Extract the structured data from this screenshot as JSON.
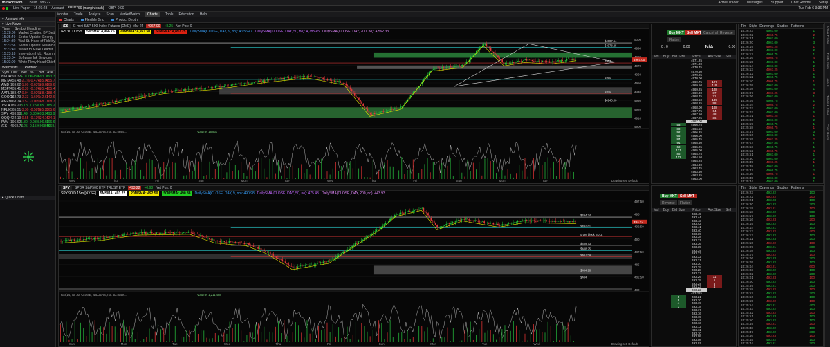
{
  "app": {
    "name": "thinkorswim",
    "build": "Build 1986.22",
    "time": "15:26:23",
    "clock": "Tue Feb 6  3:36 PM",
    "paper_label": "Live Paper",
    "account_label": "Account",
    "account_value": "******769 (margin/cash)",
    "bp_label": "OBP: 0.00"
  },
  "top_links": [
    "Active Trader",
    "Messages",
    "Support",
    "Chat Rooms",
    "Setup"
  ],
  "menu": [
    "Monitor",
    "Trade",
    "Analyze",
    "Scan",
    "MarketWatch",
    "Charts",
    "Tools",
    "Education",
    "Help"
  ],
  "active_menu": "Charts",
  "toolbar": [
    "Charts",
    "Flexible Grid",
    "Product Depth"
  ],
  "sidebar": {
    "account_info": "Account Info",
    "live_news": "Live News",
    "news_headers": [
      "Time",
      "Symbol",
      "Headline"
    ],
    "news": [
      {
        "t": "15:28:06",
        "h": "Market Chatter: BP Settles..."
      },
      {
        "t": "15:25:49",
        "h": "Sector Update: Energy"
      },
      {
        "t": "15:24:30",
        "h": "Wall St. Head of Fidelity P..."
      },
      {
        "t": "15:23:56",
        "h": "Sector Update: Financial"
      },
      {
        "t": "15:23:40",
        "h": "Waller to Make Leader..."
      },
      {
        "t": "15:23:18",
        "h": "Innovation Hub: Robinhood..."
      },
      {
        "t": "15:23:04",
        "h": "Software Ink Services"
      },
      {
        "t": "15:23:00",
        "h": "White Pkwy Head Chief..."
      }
    ],
    "watchlist_tabs": [
      "Watchlists",
      "Portfolio"
    ],
    "wl_headers": [
      "Sym",
      "Last",
      "Net",
      "%",
      "Bid",
      "Ask"
    ],
    "watchlist": [
      {
        "s": "NVDA",
        "v": [
          "693.32",
          "+10.1%",
          "1.93%",
          "693.11",
          "693.30"
        ],
        "c": "pos"
      },
      {
        "s": "META",
        "v": [
          "455.48",
          "-2.1%",
          "-0.47%",
          "455.00",
          "455.79"
        ],
        "c": "neg"
      },
      {
        "s": "AMD",
        "v": [
          "169.62",
          "-1.09",
          "-0.63%",
          "169.60",
          "169.66"
        ],
        "c": "neg"
      },
      {
        "s": "MSFT",
        "v": [
          "405.41",
          "-0.39",
          "-0.10%",
          "405.42",
          "405.45"
        ],
        "c": "neg"
      },
      {
        "s": "AAPL",
        "v": [
          "188.47",
          "-0.04",
          "-0.02%",
          "188.42",
          "188.44"
        ],
        "c": "neg"
      },
      {
        "s": "GOOGL",
        "v": [
          "142.73",
          "-2.33",
          "-1.60%",
          "142.61",
          "142.69"
        ],
        "c": "neg"
      },
      {
        "s": "AMZN",
        "v": [
          "168.74",
          "-1.57",
          "-1.00%",
          "168.73",
          "168.74"
        ],
        "c": "neg"
      },
      {
        "s": "TSLA",
        "v": [
          "185.20",
          "3.18",
          "1.75%",
          "185.13",
          "185.20"
        ],
        "c": "pos"
      },
      {
        "s": "NFLX",
        "v": [
          "565.51",
          "-3.30",
          "-0.58%",
          "565.20",
          "565.63"
        ],
        "c": "neg"
      },
      {
        "s": "SPY",
        "v": [
          "493.98",
          "1.49",
          "0.30%",
          "493.97",
          "493.99"
        ],
        "c": "pos"
      },
      {
        "s": "QQQ",
        "v": [
          "424.19",
          "-0.55",
          "-0.13%",
          "424.16",
          "424.19"
        ],
        "c": "neg"
      },
      {
        "s": "IWM",
        "v": [
          "196.62",
          "1.80",
          "0.93%",
          "196.60",
          "196.61"
        ],
        "c": "pos"
      },
      {
        "s": "/ES",
        "v": [
          "4968.75",
          "7.25",
          "0.15%",
          "4968.50",
          "4968.75"
        ],
        "c": "pos"
      }
    ],
    "quick_chart": "Quick Chart"
  },
  "chart1": {
    "symbol": "/ES",
    "desc": "E-mini S&P 500 Index Futures (CME), Mar 24",
    "interval": "/ES 90 D 15m",
    "last": "4967.00",
    "change": "+8.25",
    "netpos": "Net Pos: 0",
    "studies": [
      "5MSMA: 4,966.75",
      "20MSMA: 4,951.50",
      "50MSMA: 4,897.25",
      "DailySMA(CLOSE, DAY, 9, no): 4,956.47",
      "DailySMA(CLOSE, DAY, 50, no): 4,785.45",
      "DailySMA(CLOSE, DAY, 200, no): 4,562.33"
    ],
    "prices": [
      "5000",
      "4990",
      "4980",
      "4970",
      "4960",
      "4950",
      "4940",
      "4930",
      "4920",
      "4910",
      "4900"
    ],
    "level_labels": [
      "$4987.54",
      "$4978.25",
      "4967",
      "4950",
      "4940",
      "$4940.00"
    ],
    "days": [
      "Wed",
      "Thu",
      "Fri",
      "Sun",
      "Mon",
      "Tue",
      "Wed",
      "Thu",
      "Fri",
      "Sun",
      "Mon",
      "Tue"
    ],
    "lower": "Volume: 16,831",
    "lower_study": "RSI(14, 70, 30, CLOSE, WILDERS, no): 53.5694 ...",
    "drawing": "Drawing set: Default"
  },
  "chart2": {
    "symbol": "SPY",
    "desc": "SPDR S&P500 ETF TRUST ETF",
    "interval": "SPY 90 D 15m [NYSE]",
    "last": "493.22",
    "change": "+0.98",
    "netpos": "Net Pos: 0",
    "studies": [
      "5MSMA: 493.22",
      "20MSMA: 492.50",
      "50MSMA: 490.88",
      "DailySMA(CLOSE, DAY, 9, no): 490.98",
      "DailySMA(CLOSE, DAY, 50, no): 475.43",
      "DailySMA(CLOSE, DAY, 200, no): 443.93"
    ],
    "prices": [
      "497.50",
      "495",
      "492.50",
      "490",
      "487.50",
      "485",
      "482.50",
      "480"
    ],
    "level_labels": [
      "$494.34",
      "$492.81",
      "order block BULL",
      "$489.73",
      "$488.25",
      "$487.54",
      "$484.98",
      "$484"
    ],
    "days": [
      "Sun",
      "Mon",
      "Tue",
      "Wed",
      "Thu",
      "Fri",
      "Sun",
      "Mon",
      "Tue",
      "Wed"
    ],
    "lower": "Volume: 1,211,488",
    "lower_study": "RSI(14, 70, 30, CLOSE, WILDERS, no): 53.8059 ...",
    "drawing": "Drawing set: Default"
  },
  "ladder1": {
    "buy": "Buy MKT",
    "sell": "Sell MKT",
    "cancel": "Cancel all",
    "reverse": "Reverse",
    "flatten": "Flatten",
    "stats": [
      "0 : 0",
      "0.00",
      "N/A",
      "0.00"
    ],
    "headers": [
      "Vol",
      "Buy",
      "Bid Size",
      "Price",
      "Ask Size",
      "Sell"
    ],
    "rows": [
      [
        "",
        "",
        "",
        "4971.25",
        "",
        ""
      ],
      [
        "",
        "",
        "",
        "4971.00",
        "",
        ""
      ],
      [
        "",
        "",
        "",
        "4970.75",
        "",
        ""
      ],
      [
        "",
        "",
        "",
        "4970.50",
        "",
        ""
      ],
      [
        "",
        "",
        "",
        "4970.25",
        "",
        ""
      ],
      [
        "",
        "",
        "",
        "4970.00",
        "",
        ""
      ],
      [
        "",
        "",
        "",
        "4969.75",
        "127",
        ""
      ],
      [
        "",
        "",
        "",
        "4969.50",
        "119",
        ""
      ],
      [
        "",
        "",
        "",
        "4969.25",
        "108",
        ""
      ],
      [
        "",
        "",
        "",
        "4969.00",
        "87",
        ""
      ],
      [
        "",
        "",
        "",
        "4968.75",
        "71",
        ""
      ],
      [
        "",
        "",
        "",
        "4968.50",
        "139",
        ""
      ],
      [
        "",
        "",
        "",
        "4968.25",
        "98",
        ""
      ],
      [
        "",
        "",
        "",
        "4968.00",
        "108",
        ""
      ],
      [
        "",
        "",
        "",
        "4967.75",
        "64",
        ""
      ],
      [
        "",
        "",
        "",
        "4967.50",
        "48",
        ""
      ],
      [
        "",
        "",
        "",
        "4967.25",
        "36",
        ""
      ],
      [
        "",
        "",
        "",
        "4967.00",
        "",
        ""
      ],
      [
        "",
        "",
        "53",
        "4966.75",
        "",
        ""
      ],
      [
        "",
        "",
        "80",
        "4966.50",
        "",
        ""
      ],
      [
        "",
        "",
        "92",
        "4966.25",
        "",
        ""
      ],
      [
        "",
        "",
        "66",
        "4966.00",
        "",
        ""
      ],
      [
        "",
        "",
        "84",
        "4965.75",
        "",
        ""
      ],
      [
        "",
        "",
        "91",
        "4965.50",
        "",
        ""
      ],
      [
        "",
        "",
        "68",
        "4965.25",
        "",
        ""
      ],
      [
        "",
        "",
        "121",
        "4965.00",
        "",
        ""
      ],
      [
        "",
        "",
        "86",
        "4964.75",
        "",
        ""
      ],
      [
        "",
        "",
        "112",
        "4964.50",
        "",
        ""
      ],
      [
        "",
        "",
        "",
        "4964.25",
        "",
        ""
      ],
      [
        "",
        "",
        "",
        "4964.00",
        "",
        ""
      ],
      [
        "",
        "",
        "",
        "4963.75",
        "",
        ""
      ],
      [
        "",
        "",
        "",
        "4963.50",
        "",
        ""
      ],
      [
        "",
        "",
        "",
        "4963.25",
        "",
        ""
      ],
      [
        "",
        "",
        "",
        "4963.00",
        "",
        ""
      ]
    ]
  },
  "ladder2": {
    "buy": "Buy MKT",
    "sell": "Sell MKT",
    "cancel": "Cancel all",
    "reverse": "Reverse",
    "flatten": "Flatten",
    "headers": [
      "Vol",
      "Buy",
      "Bid Size",
      "Price",
      "Ask Size",
      "Sell"
    ],
    "rows": [
      [
        "",
        "",
        "",
        "493.45",
        "",
        ""
      ],
      [
        "",
        "",
        "",
        "493.44",
        "",
        ""
      ],
      [
        "",
        "",
        "",
        "493.43",
        "",
        ""
      ],
      [
        "",
        "",
        "",
        "493.42",
        "",
        ""
      ],
      [
        "",
        "",
        "",
        "493.41",
        "",
        ""
      ],
      [
        "",
        "",
        "",
        "493.40",
        "",
        ""
      ],
      [
        "",
        "",
        "",
        "493.39",
        "",
        ""
      ],
      [
        "",
        "",
        "",
        "493.38",
        "",
        ""
      ],
      [
        "",
        "",
        "",
        "493.37",
        "",
        ""
      ],
      [
        "",
        "",
        "",
        "493.36",
        "",
        ""
      ],
      [
        "",
        "",
        "",
        "493.35",
        "",
        ""
      ],
      [
        "",
        "",
        "",
        "493.34",
        "",
        ""
      ],
      [
        "",
        "",
        "",
        "493.33",
        "",
        ""
      ],
      [
        "",
        "",
        "",
        "493.32",
        "",
        ""
      ],
      [
        "",
        "",
        "",
        "493.31",
        "",
        ""
      ],
      [
        "",
        "",
        "",
        "493.30",
        "",
        ""
      ],
      [
        "",
        "",
        "",
        "493.29",
        "",
        ""
      ],
      [
        "",
        "",
        "",
        "493.28",
        "",
        ""
      ],
      [
        "",
        "",
        "",
        "493.27",
        "",
        ""
      ],
      [
        "",
        "",
        "",
        "493.26",
        "11",
        ""
      ],
      [
        "",
        "",
        "",
        "493.25",
        "6",
        ""
      ],
      [
        "",
        "",
        "",
        "493.24",
        "8",
        ""
      ],
      [
        "",
        "",
        "",
        "493.23",
        "4",
        ""
      ],
      [
        "",
        "",
        "",
        "493.22",
        "",
        ""
      ],
      [
        "",
        "",
        "",
        "493.225",
        "",
        ""
      ],
      [
        "",
        "",
        "5",
        "493.21",
        "",
        ""
      ],
      [
        "",
        "",
        "9",
        "493.20",
        "",
        ""
      ],
      [
        "",
        "",
        "4",
        "493.19",
        "",
        ""
      ],
      [
        "",
        "",
        "3",
        "493.18",
        "",
        ""
      ],
      [
        "",
        "",
        "",
        "493.17",
        "",
        ""
      ],
      [
        "",
        "",
        "",
        "493.16",
        "",
        ""
      ],
      [
        "",
        "",
        "",
        "493.15",
        "",
        ""
      ],
      [
        "",
        "",
        "",
        "493.14",
        "",
        ""
      ],
      [
        "",
        "",
        "",
        "493.13",
        "",
        ""
      ],
      [
        "",
        "",
        "",
        "493.12",
        "",
        ""
      ],
      [
        "",
        "",
        "",
        "493.11",
        "",
        ""
      ],
      [
        "",
        "",
        "",
        "493.10",
        "",
        ""
      ],
      [
        "",
        "",
        "",
        "493.09",
        "",
        ""
      ],
      [
        "",
        "",
        "",
        "493.08",
        "",
        ""
      ],
      [
        "",
        "",
        "",
        "493.07",
        "",
        ""
      ]
    ]
  },
  "ts_tabs": [
    "Tim",
    "Style",
    "Drawings",
    "Studies",
    "Patterns"
  ],
  "ts1": [
    [
      "15:26:23",
      "4967.00",
      "1"
    ],
    [
      "15:26:22",
      "4966.75",
      "2"
    ],
    [
      "15:26:21",
      "4967.00",
      "1"
    ],
    [
      "15:26:20",
      "4967.00",
      "3"
    ],
    [
      "15:26:19",
      "4967.25",
      "1"
    ],
    [
      "15:26:18",
      "4967.00",
      "2"
    ],
    [
      "15:26:17",
      "4966.75",
      "1"
    ],
    [
      "15:26:16",
      "4966.75",
      "4"
    ],
    [
      "15:26:15",
      "4967.00",
      "1"
    ],
    [
      "15:26:14",
      "4967.00",
      "2"
    ],
    [
      "15:26:13",
      "4967.25",
      "1"
    ],
    [
      "15:26:12",
      "4967.00",
      "1"
    ],
    [
      "15:26:11",
      "4966.75",
      "5"
    ],
    [
      "15:26:10",
      "4966.75",
      "1"
    ],
    [
      "15:26:09",
      "4967.00",
      "2"
    ],
    [
      "15:26:08",
      "4967.00",
      "1"
    ],
    [
      "15:26:07",
      "4967.25",
      "3"
    ],
    [
      "15:26:06",
      "4967.00",
      "1"
    ],
    [
      "15:26:05",
      "4966.75",
      "1"
    ],
    [
      "15:26:04",
      "4966.75",
      "2"
    ],
    [
      "15:26:03",
      "4967.00",
      "1"
    ],
    [
      "15:26:02",
      "4967.00",
      "6"
    ],
    [
      "15:26:01",
      "4967.25",
      "1"
    ],
    [
      "15:26:00",
      "4967.00",
      "2"
    ],
    [
      "15:25:59",
      "4966.75",
      "1"
    ],
    [
      "15:25:58",
      "4966.75",
      "1"
    ],
    [
      "15:25:57",
      "4967.00",
      "3"
    ],
    [
      "15:25:56",
      "4967.00",
      "1"
    ],
    [
      "15:25:55",
      "4967.25",
      "2"
    ],
    [
      "15:25:54",
      "4967.00",
      "1"
    ],
    [
      "15:25:53",
      "4966.75",
      "1"
    ],
    [
      "15:25:52",
      "4966.75",
      "4"
    ],
    [
      "15:25:51",
      "4967.00",
      "1"
    ],
    [
      "15:25:50",
      "4967.00",
      "2"
    ],
    [
      "15:25:49",
      "4967.25",
      "1"
    ],
    [
      "15:25:48",
      "4967.00",
      "1"
    ],
    [
      "15:25:47",
      "4966.75",
      "2"
    ],
    [
      "15:25:46",
      "4966.75",
      "1"
    ],
    [
      "15:25:45",
      "4967.00",
      "3"
    ],
    [
      "15:25:44",
      "4967.00",
      "1"
    ]
  ],
  "ts2": [
    [
      "15:26:23",
      "493.22",
      "100"
    ],
    [
      "15:26:22",
      "493.22",
      "200"
    ],
    [
      "15:26:21",
      "493.23",
      "100"
    ],
    [
      "15:26:20",
      "493.22",
      "300"
    ],
    [
      "15:26:19",
      "493.21",
      "100"
    ],
    [
      "15:26:18",
      "493.22",
      "500"
    ],
    [
      "15:26:17",
      "493.22",
      "100"
    ],
    [
      "15:26:16",
      "493.23",
      "200"
    ],
    [
      "15:26:15",
      "493.22",
      "100"
    ],
    [
      "15:26:14",
      "493.21",
      "100"
    ],
    [
      "15:26:13",
      "493.22",
      "400"
    ],
    [
      "15:26:12",
      "493.22",
      "100"
    ],
    [
      "15:26:11",
      "493.23",
      "200"
    ],
    [
      "15:26:10",
      "493.22",
      "100"
    ],
    [
      "15:26:09",
      "493.21",
      "300"
    ],
    [
      "15:26:08",
      "493.22",
      "100"
    ],
    [
      "15:26:07",
      "493.22",
      "100"
    ],
    [
      "15:26:06",
      "493.23",
      "200"
    ],
    [
      "15:26:05",
      "493.22",
      "100"
    ],
    [
      "15:26:04",
      "493.21",
      "600"
    ],
    [
      "15:26:03",
      "493.22",
      "100"
    ],
    [
      "15:26:02",
      "493.22",
      "200"
    ],
    [
      "15:26:01",
      "493.23",
      "100"
    ],
    [
      "15:26:00",
      "493.22",
      "100"
    ],
    [
      "15:25:59",
      "493.21",
      "300"
    ],
    [
      "15:25:58",
      "493.22",
      "100"
    ],
    [
      "15:25:57",
      "493.22",
      "200"
    ],
    [
      "15:25:56",
      "493.23",
      "100"
    ],
    [
      "15:25:55",
      "493.22",
      "100"
    ],
    [
      "15:25:54",
      "493.21",
      "400"
    ],
    [
      "15:25:53",
      "493.22",
      "100"
    ],
    [
      "15:25:52",
      "493.22",
      "200"
    ],
    [
      "15:25:51",
      "493.23",
      "100"
    ],
    [
      "15:25:50",
      "493.22",
      "100"
    ],
    [
      "15:25:49",
      "493.21",
      "200"
    ],
    [
      "15:25:48",
      "493.22",
      "100"
    ],
    [
      "15:25:47",
      "493.22",
      "300"
    ],
    [
      "15:25:46",
      "493.23",
      "100"
    ],
    [
      "15:25:45",
      "493.22",
      "100"
    ],
    [
      "15:25:44",
      "493.21",
      "200"
    ]
  ],
  "vtabs": [
    "Active Trader",
    "Trade Flash",
    "Level II",
    "Times & Sales",
    "Chart Room"
  ]
}
